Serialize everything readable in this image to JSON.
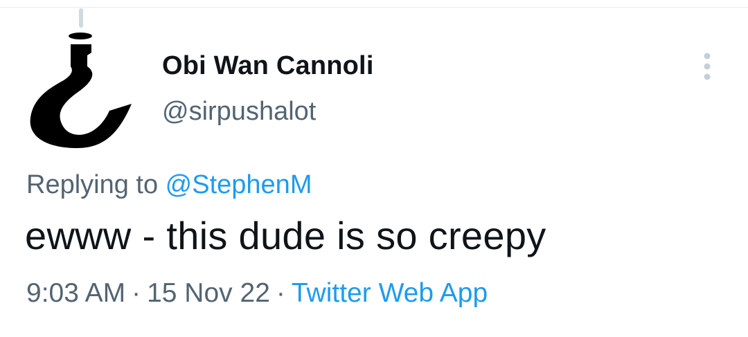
{
  "colors": {
    "text_primary": "#0f1419",
    "text_secondary": "#536471",
    "link": "#1d9bf0",
    "divider": "#e6ecf0"
  },
  "tweet": {
    "author": {
      "display_name": "Obi Wan Cannoli",
      "handle": "@sirpushalot",
      "avatar_icon": "crane-hook-icon"
    },
    "more_icon": "more-vertical-icon",
    "reply": {
      "prefix": "Replying to ",
      "mention": "@StephenM"
    },
    "text": "ewww - this dude is so creepy",
    "meta": {
      "time": "9:03 AM",
      "separator": "·",
      "date": "15 Nov 22",
      "source": "Twitter Web App"
    }
  }
}
